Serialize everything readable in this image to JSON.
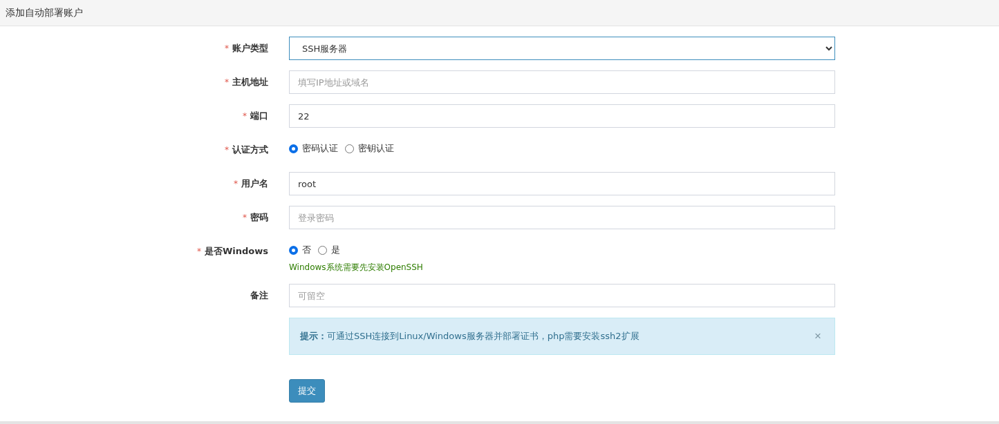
{
  "header": {
    "title": "添加自动部署账户"
  },
  "fields": [
    {
      "kind": "select",
      "label": "账户类型",
      "required_mark": "*",
      "value": "SSH服务器"
    },
    {
      "kind": "input",
      "label": "主机地址",
      "required_mark": "*",
      "placeholder": "填写IP地址或域名"
    },
    {
      "kind": "input",
      "label": "端口",
      "required_mark": "*",
      "value": "22"
    },
    {
      "kind": "radio",
      "label": "认证方式",
      "required_mark": "*",
      "options": [
        {
          "label": "密码认证",
          "selected": true
        },
        {
          "label": "密钥认证",
          "selected": false
        }
      ]
    },
    {
      "kind": "input",
      "label": "用户名",
      "required_mark": "*",
      "value": "root"
    },
    {
      "kind": "input",
      "label": "密码",
      "required_mark": "*",
      "placeholder": "登录密码"
    },
    {
      "kind": "radio",
      "label": "是否Windows",
      "required_mark": "*",
      "options": [
        {
          "label": "否",
          "selected": true
        },
        {
          "label": "是",
          "selected": false
        }
      ],
      "help": "Windows系统需要先安装OpenSSH"
    },
    {
      "kind": "input",
      "label": "备注",
      "placeholder": "可留空"
    }
  ],
  "alert": {
    "text": "**提示：**可通过SSH连接到Linux/Windows服务器并部署证书，php需要安装ssh2扩展",
    "close": "×"
  },
  "submit": "提交"
}
